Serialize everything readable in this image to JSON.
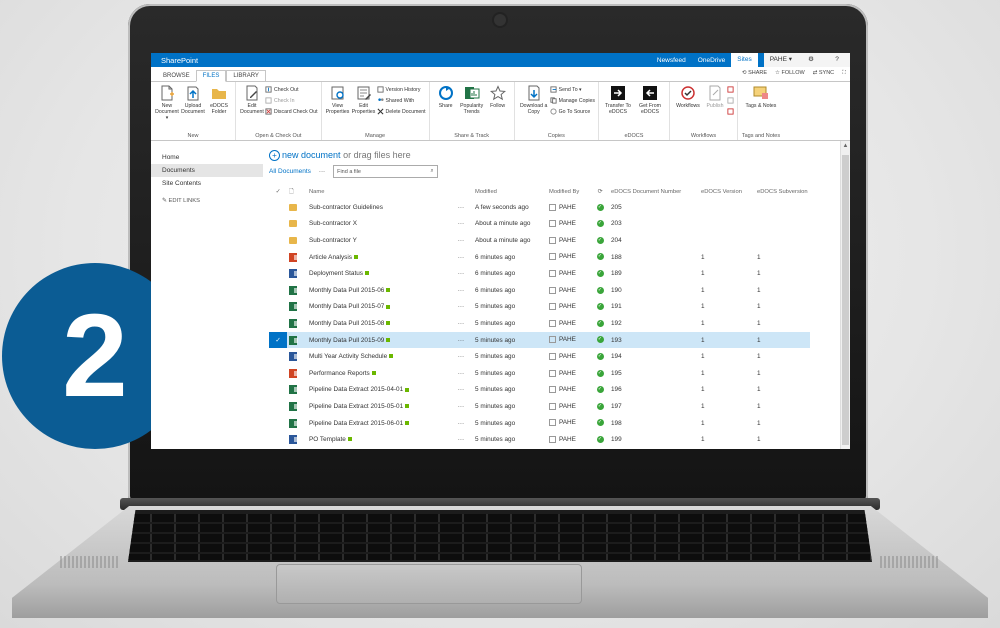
{
  "step_number": "2",
  "suitebar": {
    "brand": "SharePoint",
    "links": [
      "Newsfeed",
      "OneDrive",
      "Sites"
    ],
    "selected_link": "Sites",
    "user": "PAHE ▾",
    "gear": "⚙",
    "help": "?"
  },
  "tabs": {
    "browse": "BROWSE",
    "files": "FILES",
    "library": "LIBRARY",
    "share": "SHARE",
    "follow": "FOLLOW",
    "sync": "SYNC"
  },
  "ribbon": {
    "new_group": "New",
    "new_document": "New Document ▾",
    "upload_document": "Upload Document",
    "edocs_folder": "eDOCS Folder",
    "open_group": "Open & Check Out",
    "edit_document": "Edit Document",
    "check_out": "Check Out",
    "check_in": "Check In",
    "discard_check_out": "Discard Check Out",
    "manage_group": "Manage",
    "view_properties": "View Properties",
    "edit_properties": "Edit Properties",
    "version_history": "Version History",
    "shared_with": "Shared With",
    "delete_document": "Delete Document",
    "share_group": "Share & Track",
    "share": "Share",
    "popularity_trends": "Popularity Trends",
    "follow": "Follow",
    "copies_group": "Copies",
    "download_copy": "Download a Copy",
    "send_to": "Send To ▾",
    "manage_copies": "Manage Copies",
    "go_to_source": "Go To Source",
    "edocs_group": "eDOCS",
    "transfer_to_edocs": "Transfer To eDOCS",
    "get_from_edocs": "Get From eDOCS",
    "workflows_group": "Workflows",
    "workflows": "Workflows",
    "publish": "Publish",
    "tags_group": "Tags and Notes",
    "tags_notes": "Tags & Notes"
  },
  "leftnav": {
    "items": [
      "Home",
      "Documents",
      "Site Contents"
    ],
    "selected": "Documents",
    "edit_links": "EDIT LINKS"
  },
  "main": {
    "new_document": "new document",
    "or_drag": "or drag files here",
    "view": "All Documents",
    "view_more": "···",
    "search_placeholder": "Find a file"
  },
  "columns": {
    "name": "Name",
    "modified": "Modified",
    "modified_by": "Modified By",
    "edocs_number": "eDOCS Document Number",
    "edocs_version": "eDOCS Version",
    "edocs_subversion": "eDOCS Subversion"
  },
  "rows": [
    {
      "type": "folder",
      "name": "Sub-contractor Guidelines",
      "new": false,
      "modified": "A few seconds ago",
      "by": "PAHE",
      "num": "205",
      "ver": "",
      "sub": "",
      "selected": false
    },
    {
      "type": "folder",
      "name": "Sub-contractor X",
      "new": false,
      "modified": "About a minute ago",
      "by": "PAHE",
      "num": "203",
      "ver": "",
      "sub": "",
      "selected": false
    },
    {
      "type": "folder",
      "name": "Sub-contractor Y",
      "new": false,
      "modified": "About a minute ago",
      "by": "PAHE",
      "num": "204",
      "ver": "",
      "sub": "",
      "selected": false
    },
    {
      "type": "ppt",
      "name": "Article Analysis",
      "new": true,
      "modified": "6 minutes ago",
      "by": "PAHE",
      "num": "188",
      "ver": "1",
      "sub": "1",
      "selected": false
    },
    {
      "type": "word",
      "name": "Deployment Status",
      "new": true,
      "modified": "6 minutes ago",
      "by": "PAHE",
      "num": "189",
      "ver": "1",
      "sub": "1",
      "selected": false
    },
    {
      "type": "excel",
      "name": "Monthly Data Pull 2015-06",
      "new": true,
      "modified": "6 minutes ago",
      "by": "PAHE",
      "num": "190",
      "ver": "1",
      "sub": "1",
      "selected": false
    },
    {
      "type": "excel",
      "name": "Monthly Data Pull 2015-07",
      "new": true,
      "modified": "5 minutes ago",
      "by": "PAHE",
      "num": "191",
      "ver": "1",
      "sub": "1",
      "selected": false
    },
    {
      "type": "excel",
      "name": "Monthly Data Pull 2015-08",
      "new": true,
      "modified": "5 minutes ago",
      "by": "PAHE",
      "num": "192",
      "ver": "1",
      "sub": "1",
      "selected": false
    },
    {
      "type": "excel",
      "name": "Monthly Data Pull 2015-09",
      "new": true,
      "modified": "5 minutes ago",
      "by": "PAHE",
      "num": "193",
      "ver": "1",
      "sub": "1",
      "selected": true
    },
    {
      "type": "word",
      "name": "Multi Year Activity Schedule",
      "new": true,
      "modified": "5 minutes ago",
      "by": "PAHE",
      "num": "194",
      "ver": "1",
      "sub": "1",
      "selected": false
    },
    {
      "type": "ppt",
      "name": "Performance Reports",
      "new": true,
      "modified": "5 minutes ago",
      "by": "PAHE",
      "num": "195",
      "ver": "1",
      "sub": "1",
      "selected": false
    },
    {
      "type": "excel",
      "name": "Pipeline Data Extract 2015-04-01",
      "new": true,
      "modified": "5 minutes ago",
      "by": "PAHE",
      "num": "196",
      "ver": "1",
      "sub": "1",
      "selected": false
    },
    {
      "type": "excel",
      "name": "Pipeline Data Extract 2015-05-01",
      "new": true,
      "modified": "5 minutes ago",
      "by": "PAHE",
      "num": "197",
      "ver": "1",
      "sub": "1",
      "selected": false
    },
    {
      "type": "excel",
      "name": "Pipeline Data Extract 2015-06-01",
      "new": true,
      "modified": "5 minutes ago",
      "by": "PAHE",
      "num": "198",
      "ver": "1",
      "sub": "1",
      "selected": false
    },
    {
      "type": "word",
      "name": "PO Template",
      "new": true,
      "modified": "5 minutes ago",
      "by": "PAHE",
      "num": "199",
      "ver": "1",
      "sub": "1",
      "selected": false
    }
  ],
  "colors": {
    "suitebar": "#0072c6",
    "badge": "#0b5c94",
    "selected_row": "#cde6f7"
  }
}
